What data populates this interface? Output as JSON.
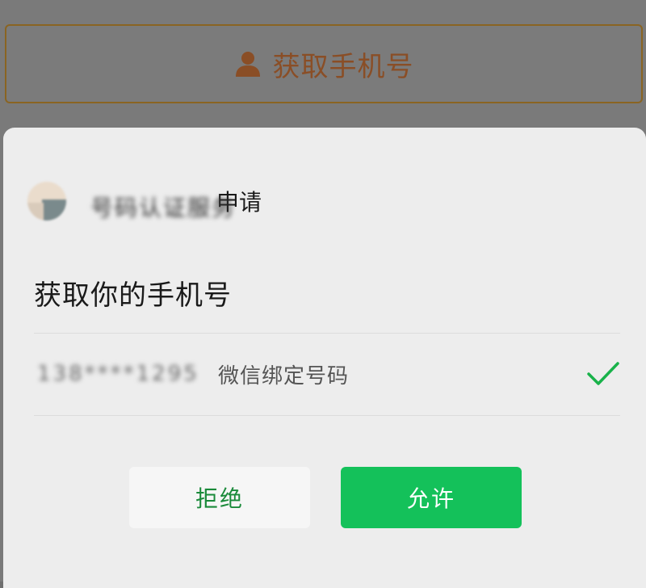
{
  "background": {
    "get_phone_button_label": "获取手机号"
  },
  "sheet": {
    "service_name": "号码认证服务",
    "apply_label": "申请",
    "title": "获取你的手机号",
    "phone_number": "138****1295",
    "phone_description": "微信绑定号码",
    "reject_label": "拒绝",
    "allow_label": "允许"
  },
  "colors": {
    "accent_green": "#14c15a",
    "check_green": "#19b24a",
    "brand_brown": "#8a4e26"
  },
  "icons": {
    "background_button": "person-icon",
    "phone_row": "checkmark-icon"
  }
}
